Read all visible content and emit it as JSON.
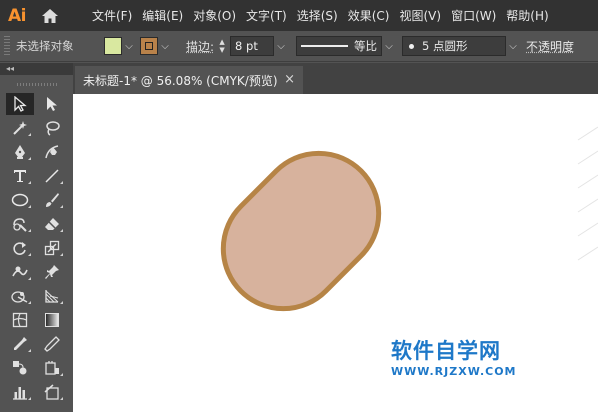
{
  "app": {
    "logo": "Ai"
  },
  "menu": [
    "文件(F)",
    "编辑(E)",
    "对象(O)",
    "文字(T)",
    "选择(S)",
    "效果(C)",
    "视图(V)",
    "窗口(W)",
    "帮助(H)"
  ],
  "control_bar": {
    "selection_label": "未选择对象",
    "fill_color": "#d9e8a0",
    "stroke_color": "#b9824a",
    "stroke_label": "描边:",
    "stroke_weight": "8 pt",
    "stroke_profile": "等比",
    "brush": "5 点圆形",
    "opacity_label": "不透明度"
  },
  "toolbox": {
    "collapse": "◂◂"
  },
  "document": {
    "tab_title": "未标题-1* @ 56.08% (CMYK/预览)",
    "close": "×"
  },
  "artwork": {
    "shape_fill": "#d7b29d",
    "shape_stroke": "#b68446"
  },
  "watermark": {
    "name": "软件自学网",
    "url": "WWW.RJZXW.COM"
  }
}
